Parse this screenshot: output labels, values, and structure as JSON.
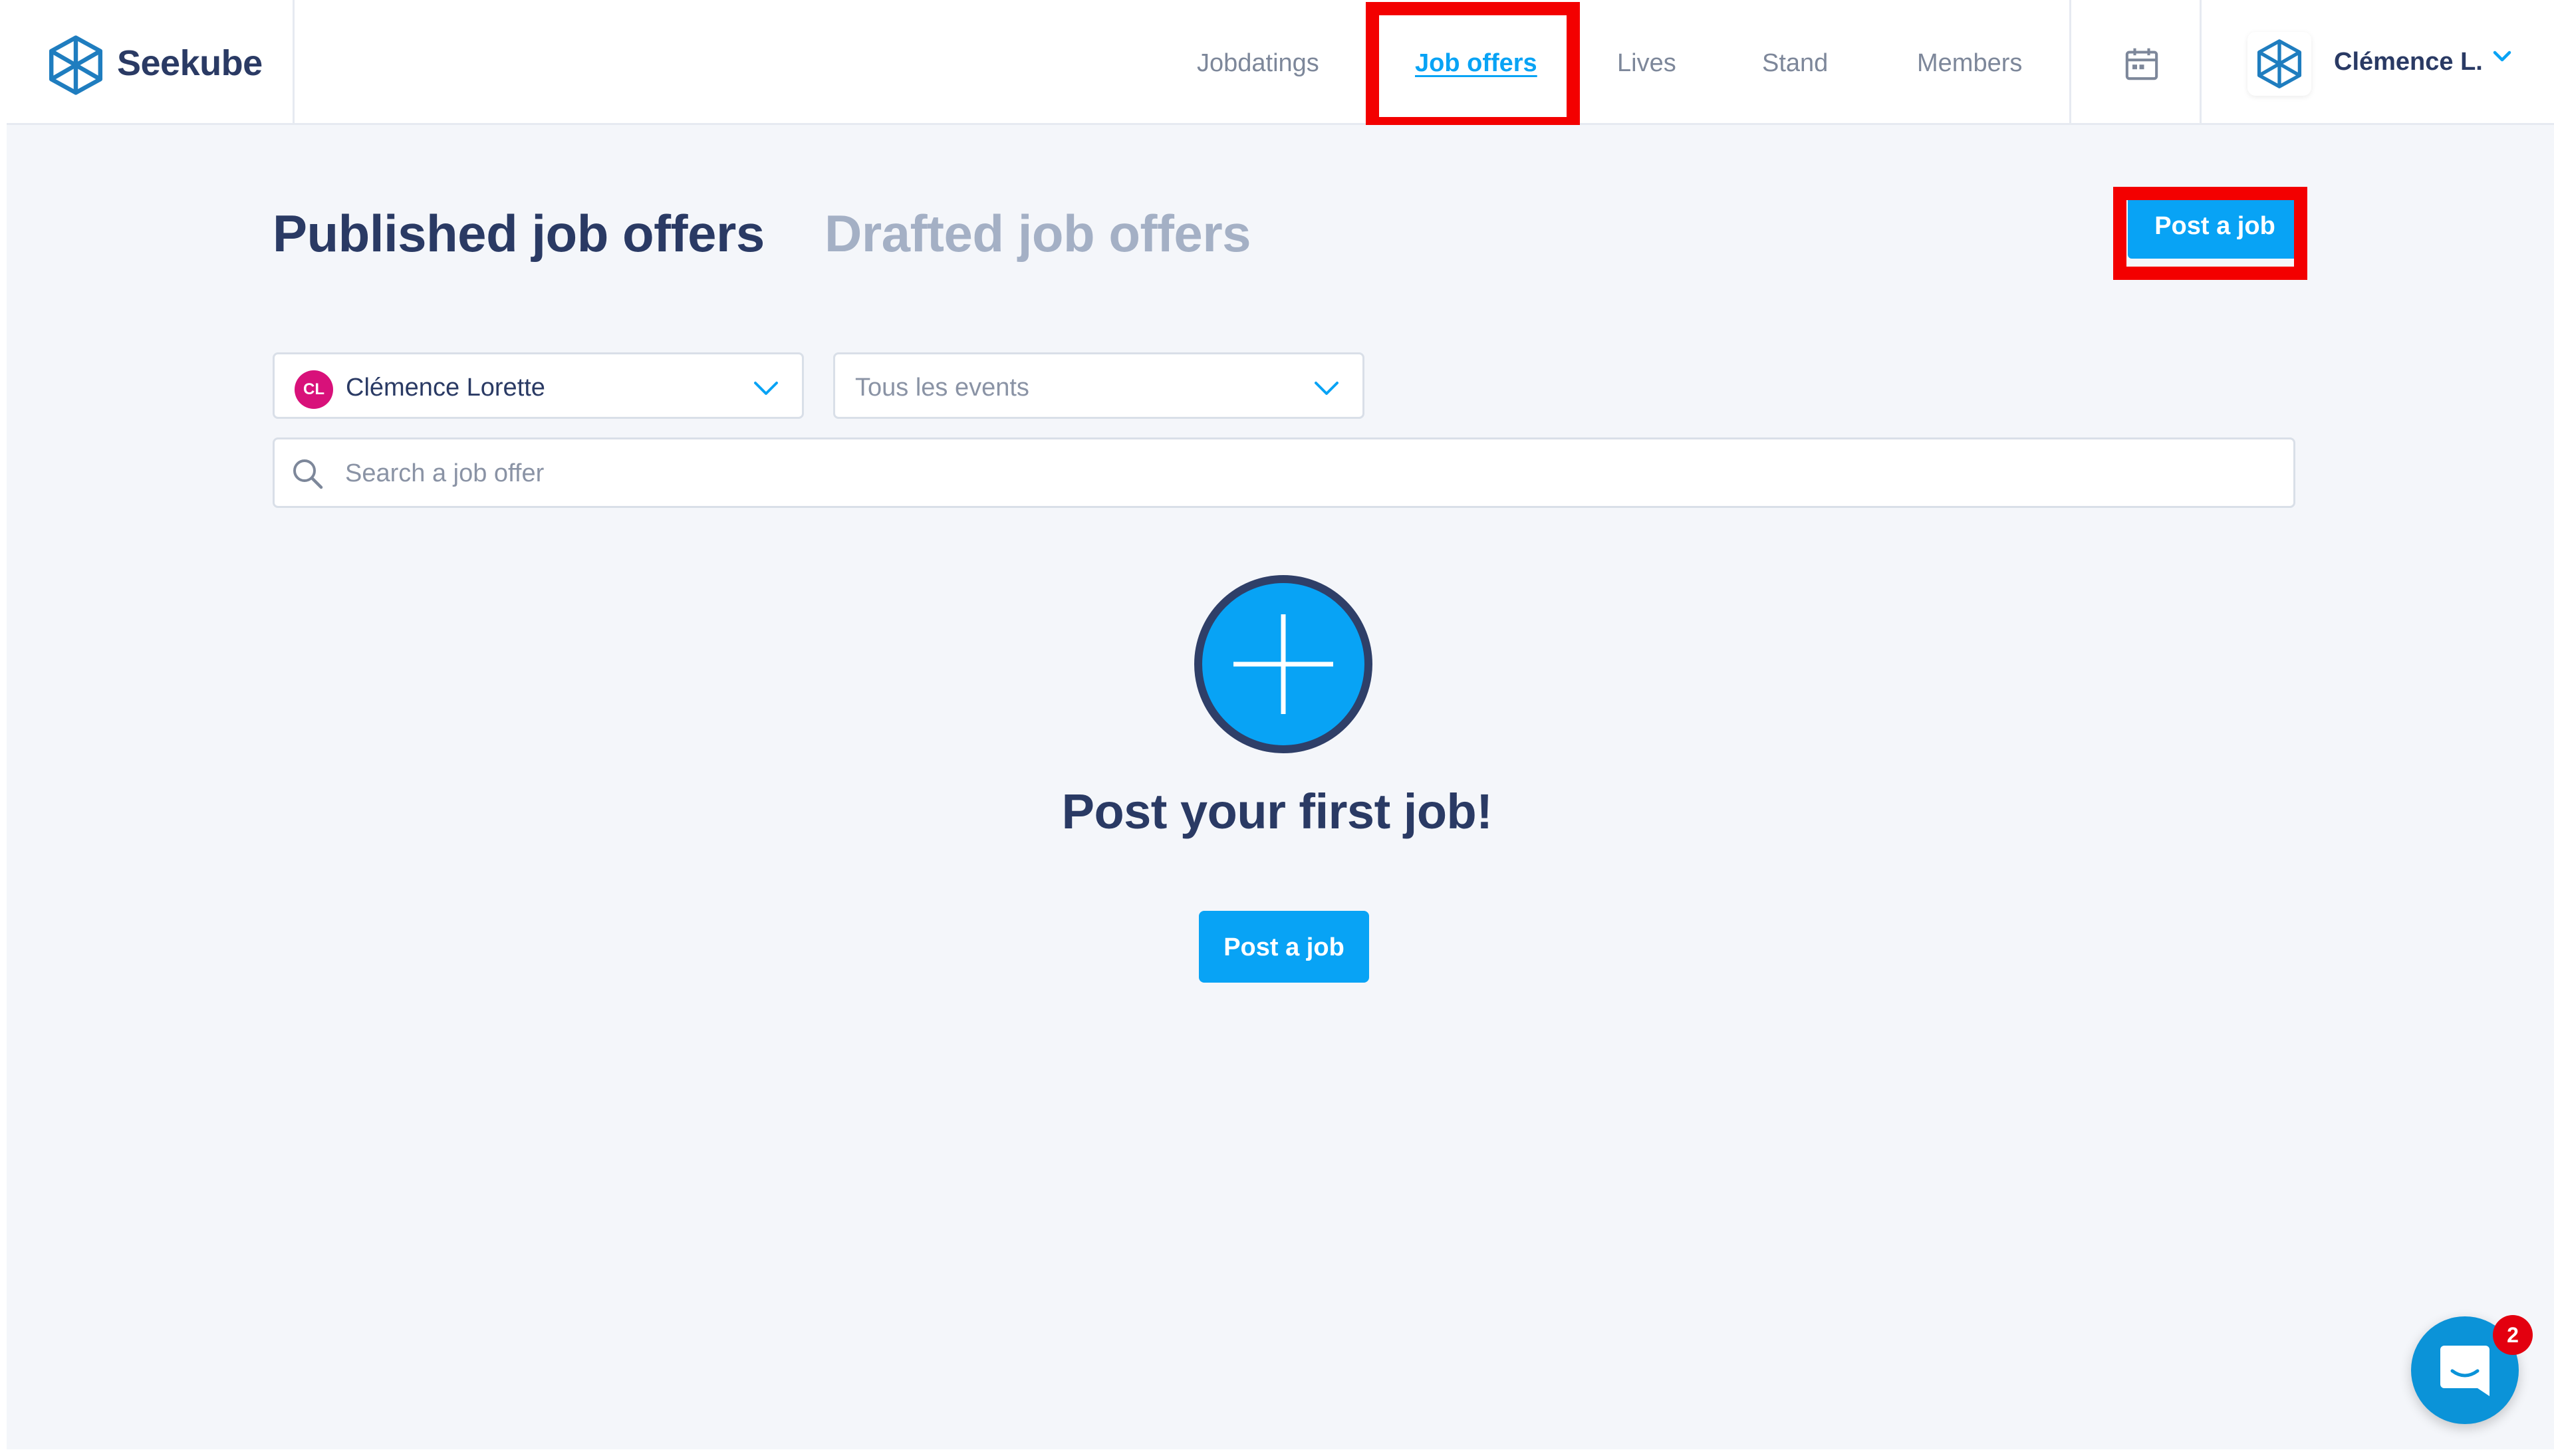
{
  "brand": {
    "name": "Seekube",
    "logo_icon": "seekube-cube-logo"
  },
  "nav": {
    "items": [
      {
        "label": "Jobdatings"
      },
      {
        "label": "Job offers",
        "active": true
      },
      {
        "label": "Lives"
      },
      {
        "label": "Stand"
      },
      {
        "label": "Members"
      }
    ],
    "calendar_icon": "calendar-icon"
  },
  "user": {
    "display_name": "Clémence L.",
    "menu_icon": "chevron-down-icon"
  },
  "tabs": {
    "published": "Published job offers",
    "drafted": "Drafted job offers"
  },
  "actions": {
    "post_job_label": "Post a job"
  },
  "filters": {
    "owner": {
      "initials": "CL",
      "value": "Clémence Lorette",
      "badge_color": "#d8117a"
    },
    "events": {
      "placeholder": "Tous les events"
    }
  },
  "search": {
    "placeholder": "Search a job offer",
    "value": ""
  },
  "empty_state": {
    "title": "Post your first job!",
    "button_label": "Post a job",
    "icon": "plus-circle-icon"
  },
  "chat": {
    "badge_count": "2",
    "icon": "chat-icon"
  },
  "colors": {
    "accent": "#08a3f5",
    "navy": "#2a3a64",
    "highlight": "#f30000",
    "page_bg": "#f4f6fa"
  }
}
